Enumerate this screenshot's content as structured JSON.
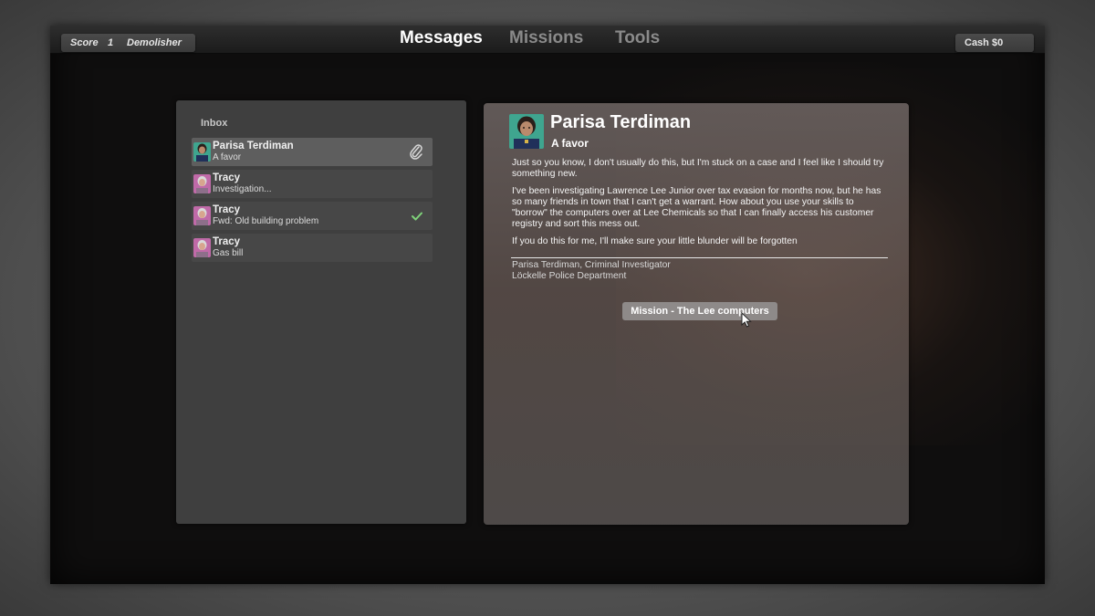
{
  "topbar": {
    "score_label": "Score",
    "score_value": "1",
    "rank": "Demolisher",
    "tabs": [
      {
        "label": "Messages",
        "active": true
      },
      {
        "label": "Missions",
        "active": false
      },
      {
        "label": "Tools",
        "active": false
      }
    ],
    "cash": "Cash $0"
  },
  "inbox": {
    "title": "Inbox",
    "items": [
      {
        "sender": "Parisa Terdiman",
        "subject": "A favor",
        "selected": true,
        "status_icon": "paperclip-icon",
        "avatar": "police-woman-avatar"
      },
      {
        "sender": "Tracy",
        "subject": "Investigation...",
        "selected": false,
        "status_icon": "",
        "avatar": "tracy-avatar"
      },
      {
        "sender": "Tracy",
        "subject": "Fwd: Old building problem",
        "selected": false,
        "status_icon": "checkmark-icon",
        "avatar": "tracy-avatar"
      },
      {
        "sender": "Tracy",
        "subject": "Gas bill",
        "selected": false,
        "status_icon": "",
        "avatar": "tracy-avatar"
      }
    ]
  },
  "reader": {
    "sender": "Parisa Terdiman",
    "subject": "A favor",
    "paragraphs": [
      "Just so you know, I don't usually do this, but I'm stuck on a case and I feel like I should try something new.",
      "I've been investigating Lawrence Lee Junior over tax evasion for months now, but he has so many friends in town that I can't get a warrant. How about you use your skills to \"borrow\" the computers over at Lee Chemicals so that I can finally access his customer registry and sort this mess out.",
      "If you do this for me, I'll make sure your little blunder will be forgotten"
    ],
    "signature_name": "Parisa Terdiman, Criminal Investigator",
    "signature_dept": "Löckelle Police Department",
    "mission_button": "Mission - The Lee computers"
  },
  "colors": {
    "active_tab": "#ffffff",
    "inactive_tab": "#8a8a8a",
    "checkmark": "#7fd37a"
  }
}
